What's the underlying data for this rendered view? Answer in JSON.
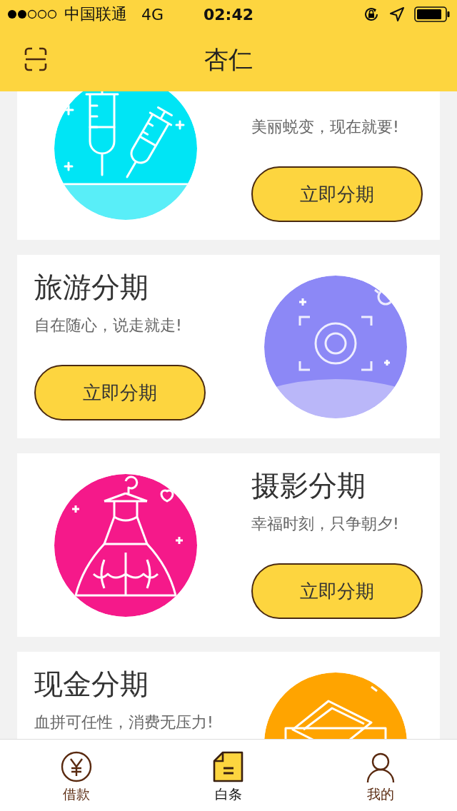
{
  "status_bar": {
    "carrier": "中国联通",
    "network": "4G",
    "time": "02:42"
  },
  "header": {
    "title": "杏仁"
  },
  "cards": [
    {
      "kind": "syringe",
      "color": "#00e5f5",
      "subtitle": "美丽蜕变，现在就要!",
      "button": "立即分期"
    },
    {
      "kind": "camera",
      "color": "#8c88f6",
      "title": "旅游分期",
      "subtitle": "自在随心，说走就走!",
      "button": "立即分期"
    },
    {
      "kind": "dress",
      "color": "#f5198a",
      "title": "摄影分期",
      "subtitle": "幸福时刻，只争朝夕!",
      "button": "立即分期"
    },
    {
      "kind": "cash",
      "color": "#ffa400",
      "title": "现金分期",
      "subtitle": "血拼可任性，消费无压力!"
    }
  ],
  "tabs": [
    {
      "kind": "yen",
      "label": "借款",
      "selected": false
    },
    {
      "kind": "note",
      "label": "白条",
      "selected": true
    },
    {
      "kind": "person",
      "label": "我的",
      "selected": false
    }
  ]
}
